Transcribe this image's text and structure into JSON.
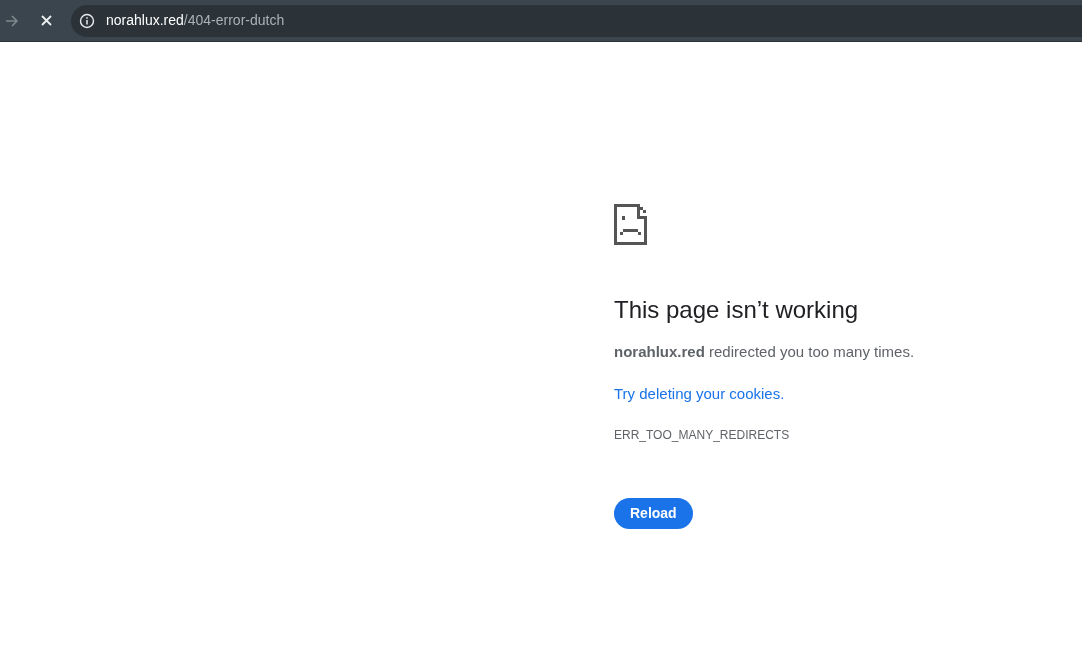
{
  "toolbar": {
    "forward_disabled": true
  },
  "address_bar": {
    "host": "norahlux.red",
    "path": "/404-error-dutch"
  },
  "error": {
    "title": "This page isn’t working",
    "message": "**norahlux.red** redirected you too many times.",
    "link": "Try deleting your cookies.",
    "code": "ERR_TOO_MANY_REDIRECTS",
    "button": "Reload"
  }
}
